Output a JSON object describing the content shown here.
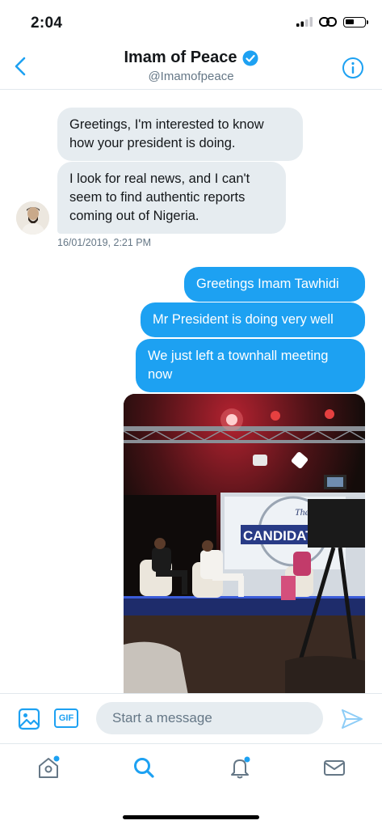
{
  "status_bar": {
    "time": "2:04"
  },
  "header": {
    "title": "Imam of Peace",
    "handle": "@Imamofpeace"
  },
  "conversation": {
    "incoming": [
      {
        "text": "Greetings, I'm interested to know how your president is doing."
      },
      {
        "text": "I look for real news, and I can't seem to find authentic reports coming out of Nigeria."
      }
    ],
    "incoming_timestamp": "16/01/2019, 2:21 PM",
    "outgoing": [
      {
        "text": "Greetings Imam Tawhidi"
      },
      {
        "text": "Mr President is doing very well"
      },
      {
        "text": "We just left a townhall meeting now"
      }
    ],
    "photo": {
      "sign_top": "The",
      "sign_main": "CANDIDAT"
    }
  },
  "composer": {
    "gif_label": "GIF",
    "placeholder": "Start a message"
  },
  "colors": {
    "accent": "#1da1f2",
    "incoming_bubble": "#e6ecf0",
    "secondary_text": "#657786"
  }
}
